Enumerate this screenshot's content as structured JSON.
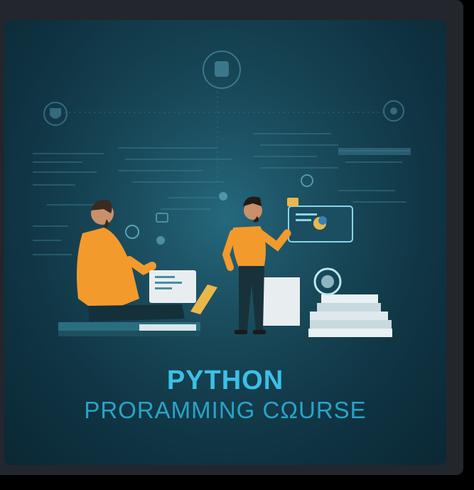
{
  "poster": {
    "title": "PYTHON",
    "subtitle": "PRORAMMING CΩURSE"
  },
  "colors": {
    "accent": "#3cc0e6",
    "shirt": "#f39a2c",
    "background": "#174656"
  },
  "icons": [
    "python-logo-icon",
    "gear-icon",
    "shield-icon",
    "cloud-icon"
  ]
}
